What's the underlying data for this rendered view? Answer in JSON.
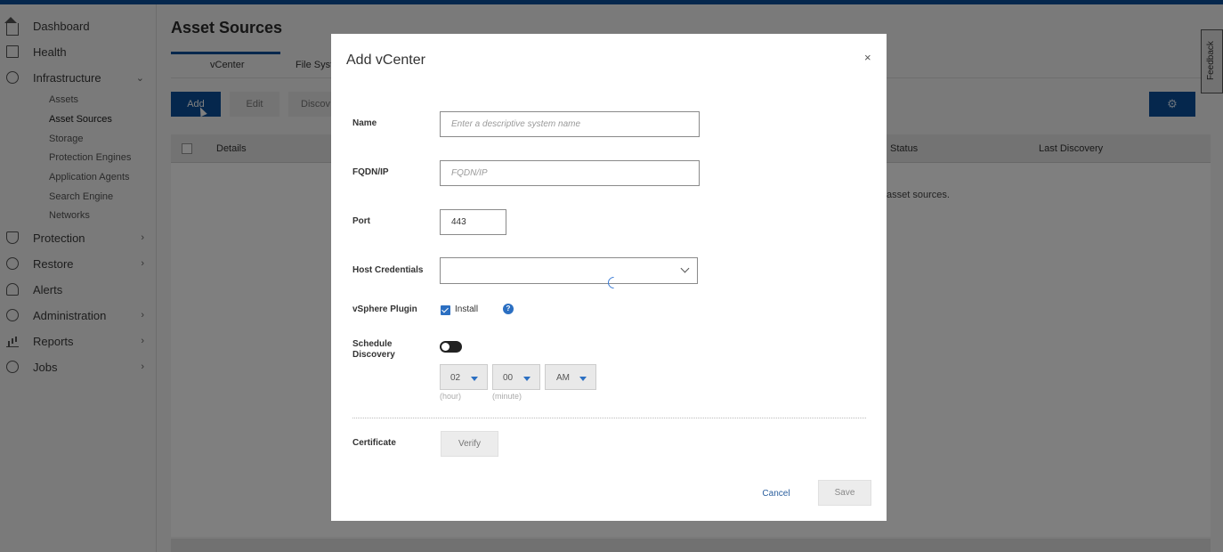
{
  "sidebar": {
    "items": [
      {
        "label": "Dashboard",
        "icon": "home-icon"
      },
      {
        "label": "Health",
        "icon": "health-icon"
      },
      {
        "label": "Infrastructure",
        "icon": "infrastructure-icon",
        "expanded": true
      },
      {
        "label": "Protection",
        "icon": "shield-icon"
      },
      {
        "label": "Restore",
        "icon": "restore-icon"
      },
      {
        "label": "Alerts",
        "icon": "bell-icon"
      },
      {
        "label": "Administration",
        "icon": "admin-icon"
      },
      {
        "label": "Reports",
        "icon": "reports-icon"
      },
      {
        "label": "Jobs",
        "icon": "clock-icon"
      }
    ],
    "infrastructure_sub": [
      "Assets",
      "Asset Sources",
      "Storage",
      "Protection Engines",
      "Application Agents",
      "Search Engine",
      "Networks"
    ]
  },
  "main": {
    "title": "Asset Sources",
    "tabs": [
      "vCenter",
      "File Syst"
    ],
    "toolbar": {
      "add": "Add",
      "edit": "Edit",
      "discover": "Discov"
    },
    "table": {
      "headers": {
        "details": "Details",
        "status": "Status",
        "last_discovery": "Last Discovery"
      },
      "empty_message": "asset sources."
    },
    "feedback": "Feedback"
  },
  "modal": {
    "title": "Add vCenter",
    "close": "×",
    "fields": {
      "name_label": "Name",
      "name_placeholder": "Enter a descriptive system name",
      "fqdn_label": "FQDN/IP",
      "fqdn_placeholder": "FQDN/IP",
      "port_label": "Port",
      "port_value": "443",
      "host_credentials_label": "Host Credentials",
      "vsphere_label": "vSphere Plugin",
      "install_label": "Install",
      "schedule_label_1": "Schedule",
      "schedule_label_2": "Discovery",
      "hour_value": "02",
      "minute_value": "00",
      "ampm_value": "AM",
      "hour_hint": "(hour)",
      "minute_hint": "(minute)",
      "certificate_label": "Certificate",
      "verify_button": "Verify"
    },
    "footer": {
      "cancel": "Cancel",
      "save": "Save"
    }
  },
  "colors": {
    "brand": "#0b4f9a",
    "accent": "#2b6fc2"
  }
}
